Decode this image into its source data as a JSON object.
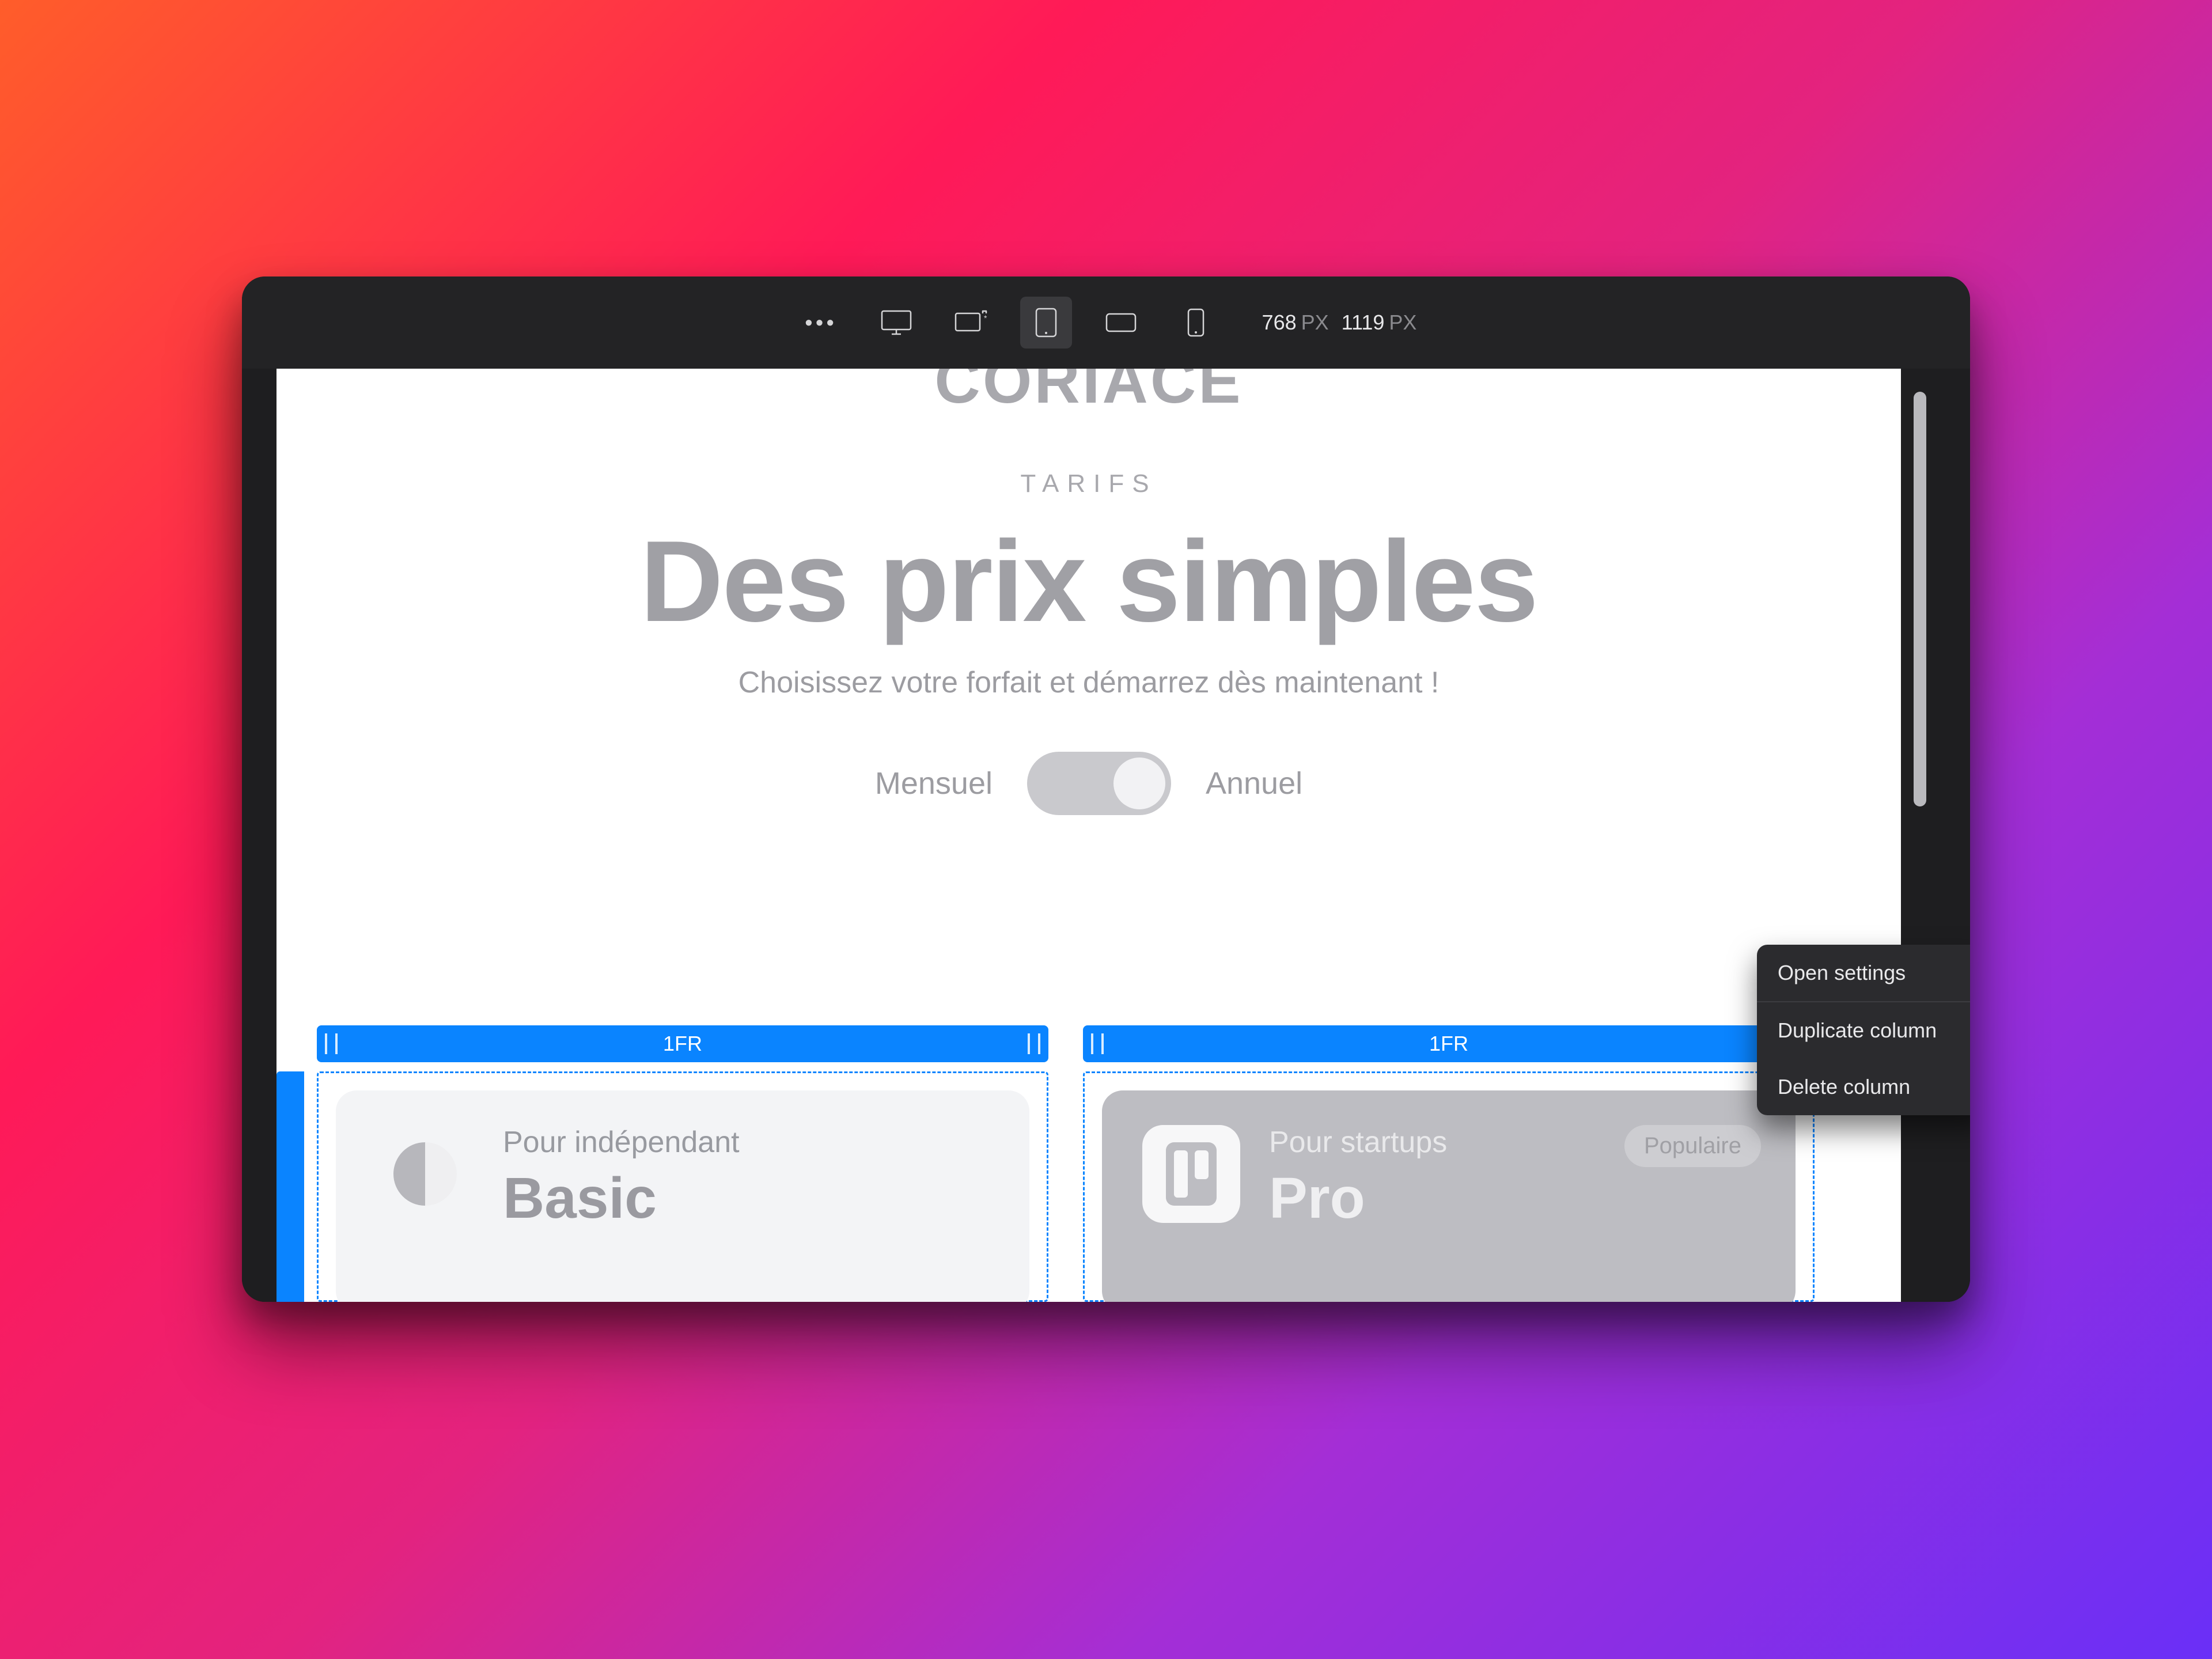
{
  "toolbar": {
    "width_value": "768",
    "width_unit": "PX",
    "height_value": "1119",
    "height_unit": "PX"
  },
  "page": {
    "brand": "CORIACE",
    "eyebrow": "TARIFS",
    "headline": "Des prix simples",
    "subhead": "Choisissez votre forfait et démarrez dès maintenant !",
    "toggle": {
      "left": "Mensuel",
      "right": "Annuel"
    }
  },
  "grid": {
    "col_label": "1FR",
    "add_label": "+",
    "cards": [
      {
        "eyebrow": "Pour indépendant",
        "name": "Basic"
      },
      {
        "eyebrow": "Pour startups",
        "name": "Pro",
        "badge": "Populaire"
      }
    ]
  },
  "context_menu": {
    "open": "Open settings",
    "duplicate": "Duplicate column",
    "delete": "Delete column"
  }
}
